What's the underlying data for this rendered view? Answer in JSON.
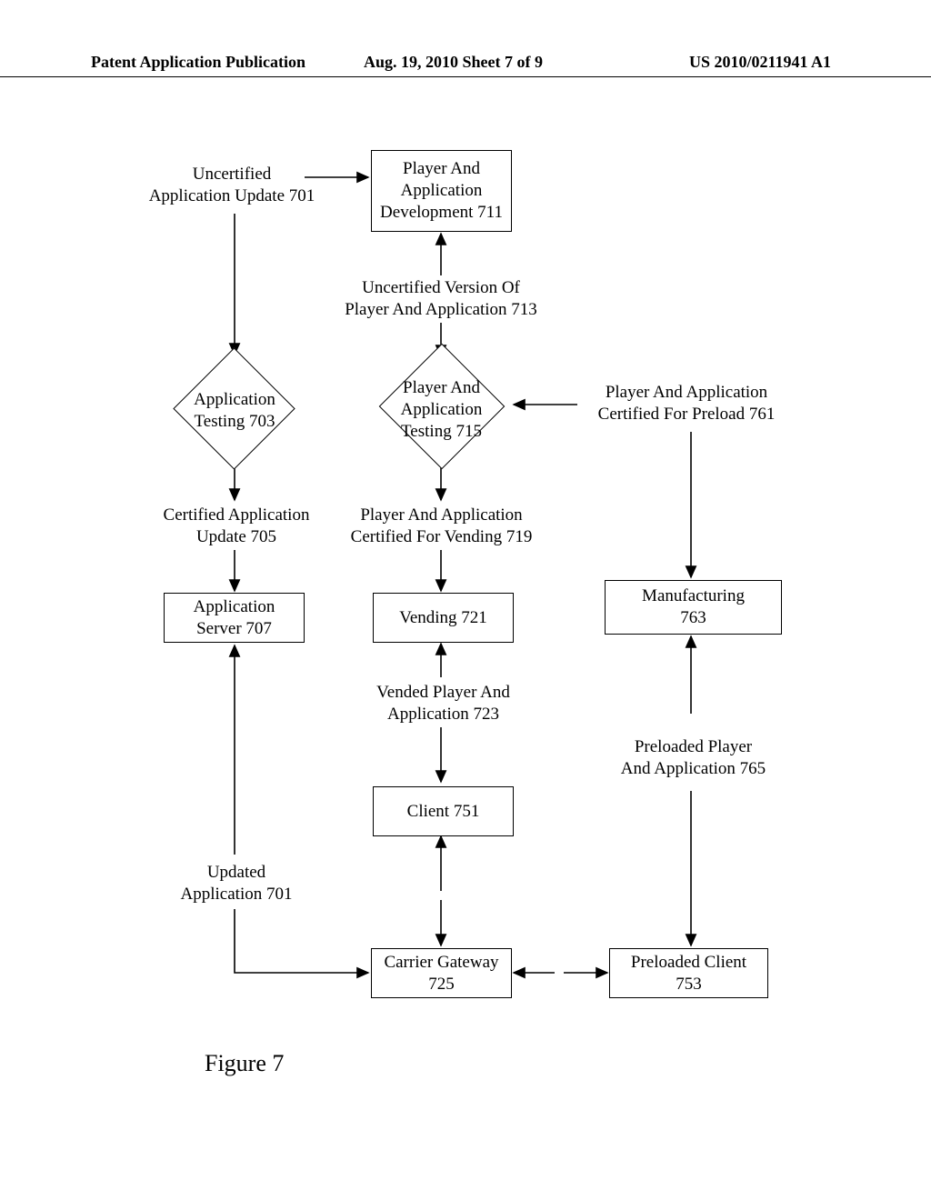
{
  "header": {
    "left": "Patent Application Publication",
    "mid": "Aug. 19, 2010   Sheet 7 of 9",
    "right": "US 2010/0211941 A1"
  },
  "labels": {
    "uncert_update": "Uncertified\nApplication Update 701",
    "dev_box": "Player And\nApplication\nDevelopment 711",
    "uncert_version": "Uncertified Version Of\nPlayer And Application 713",
    "app_testing": "Application\nTesting 703",
    "pa_testing": "Player And\nApplication\nTesting 715",
    "cert_preload": "Player And Application\nCertified For Preload 761",
    "cert_update": "Certified Application\nUpdate 705",
    "cert_vending": "Player And Application\nCertified For Vending 719",
    "app_server": "Application\nServer 707",
    "vending": "Vending 721",
    "manufacturing": "Manufacturing\n763",
    "vended_pa": "Vended Player And\nApplication 723",
    "preloaded_pa": "Preloaded Player\nAnd Application 765",
    "client": "Client 751",
    "updated_app": "Updated\nApplication 701",
    "carrier_gw": "Carrier Gateway\n725",
    "preloaded_client": "Preloaded Client\n753"
  },
  "figure": "Figure 7"
}
